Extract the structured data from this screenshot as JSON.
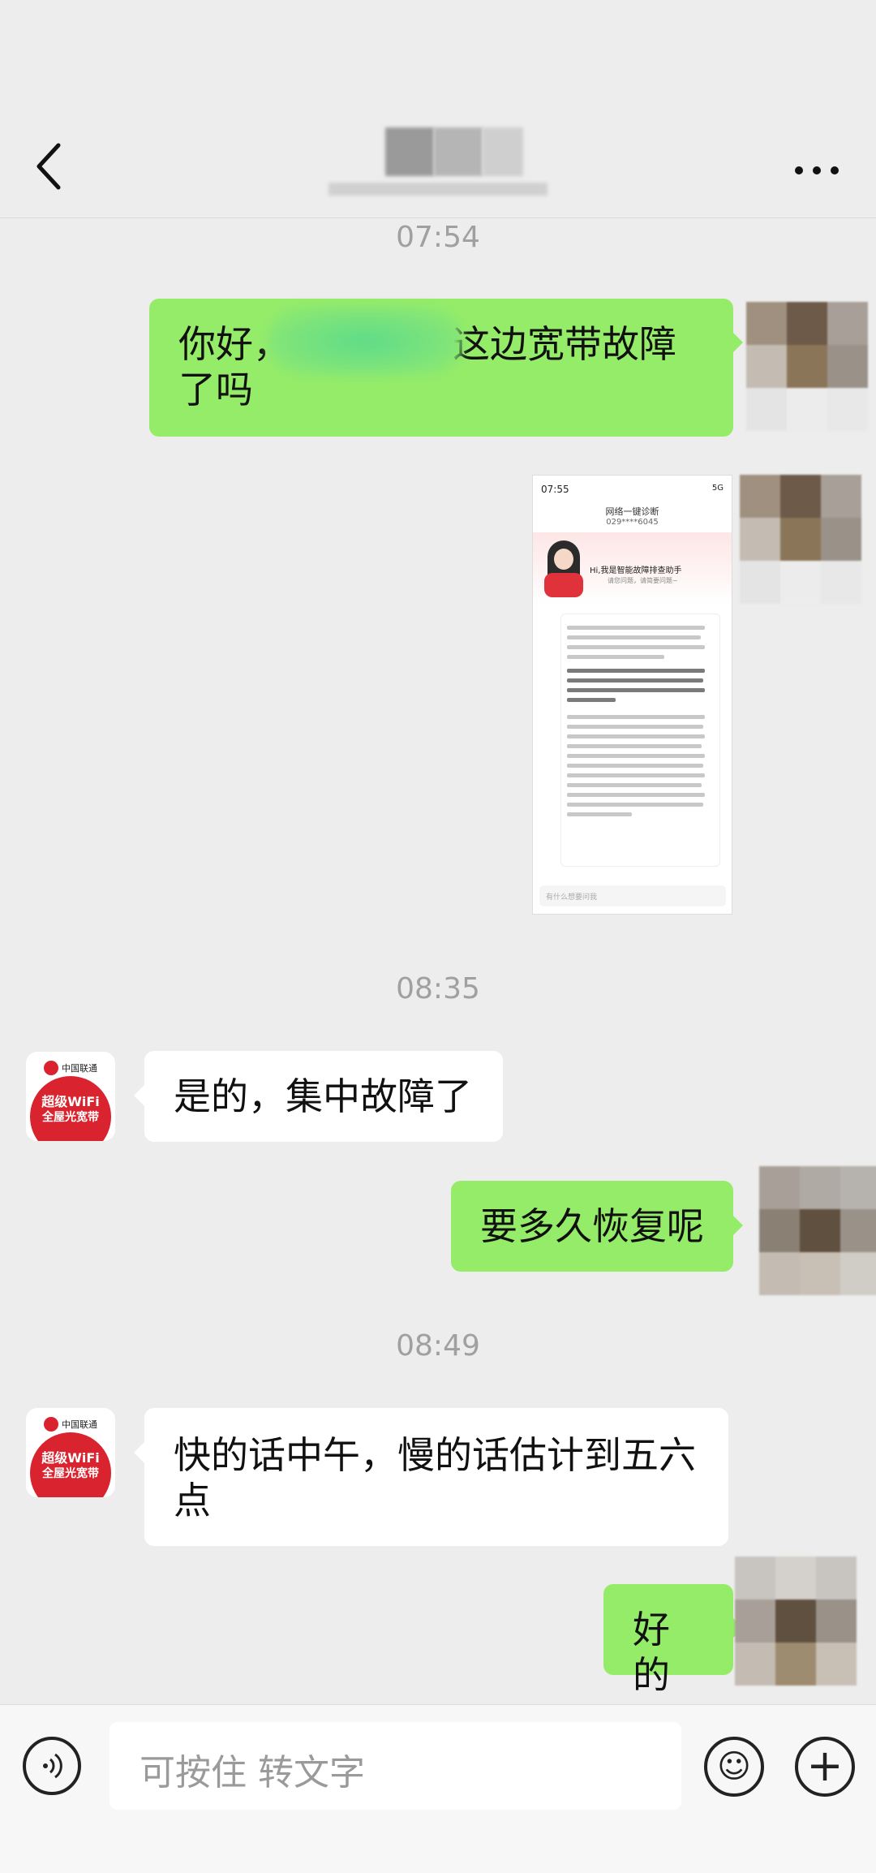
{
  "header": {
    "back_icon": "chevron-left-icon",
    "title": "",
    "more_icon": "more-dots-icon"
  },
  "messages": {
    "ts1": "07:54",
    "m1": "你好，",
    "m1_tail": "这边宽带故障了吗",
    "screenshot": {
      "time": "07:55",
      "status": "5G",
      "title": "网络一键诊断",
      "number": "029****6045",
      "greeting": "Hi,我是智能故障排查助手",
      "greeting_sub": "请您问题，请简要问题~",
      "input_placeholder": "有什么想要问我"
    },
    "ts2": "08:35",
    "m2": "是的，集中故障了",
    "m3": "要多久恢复呢",
    "ts3": "08:49",
    "m4": "快的话中午，慢的话估计到五六点",
    "m5": "好的"
  },
  "contact_avatar": {
    "brand": "中国联通",
    "line1": "超级WiFi",
    "line2": "全屋光宽带"
  },
  "composer": {
    "placeholder": "可按住 转文字",
    "voice_icon": "voice-icon",
    "emoji_icon": "emoji-icon",
    "plus_icon": "plus-icon"
  },
  "colors": {
    "me_bubble": "#95ec69",
    "them_bubble": "#ffffff",
    "background": "#ededed",
    "brand_red": "#d9232e"
  }
}
